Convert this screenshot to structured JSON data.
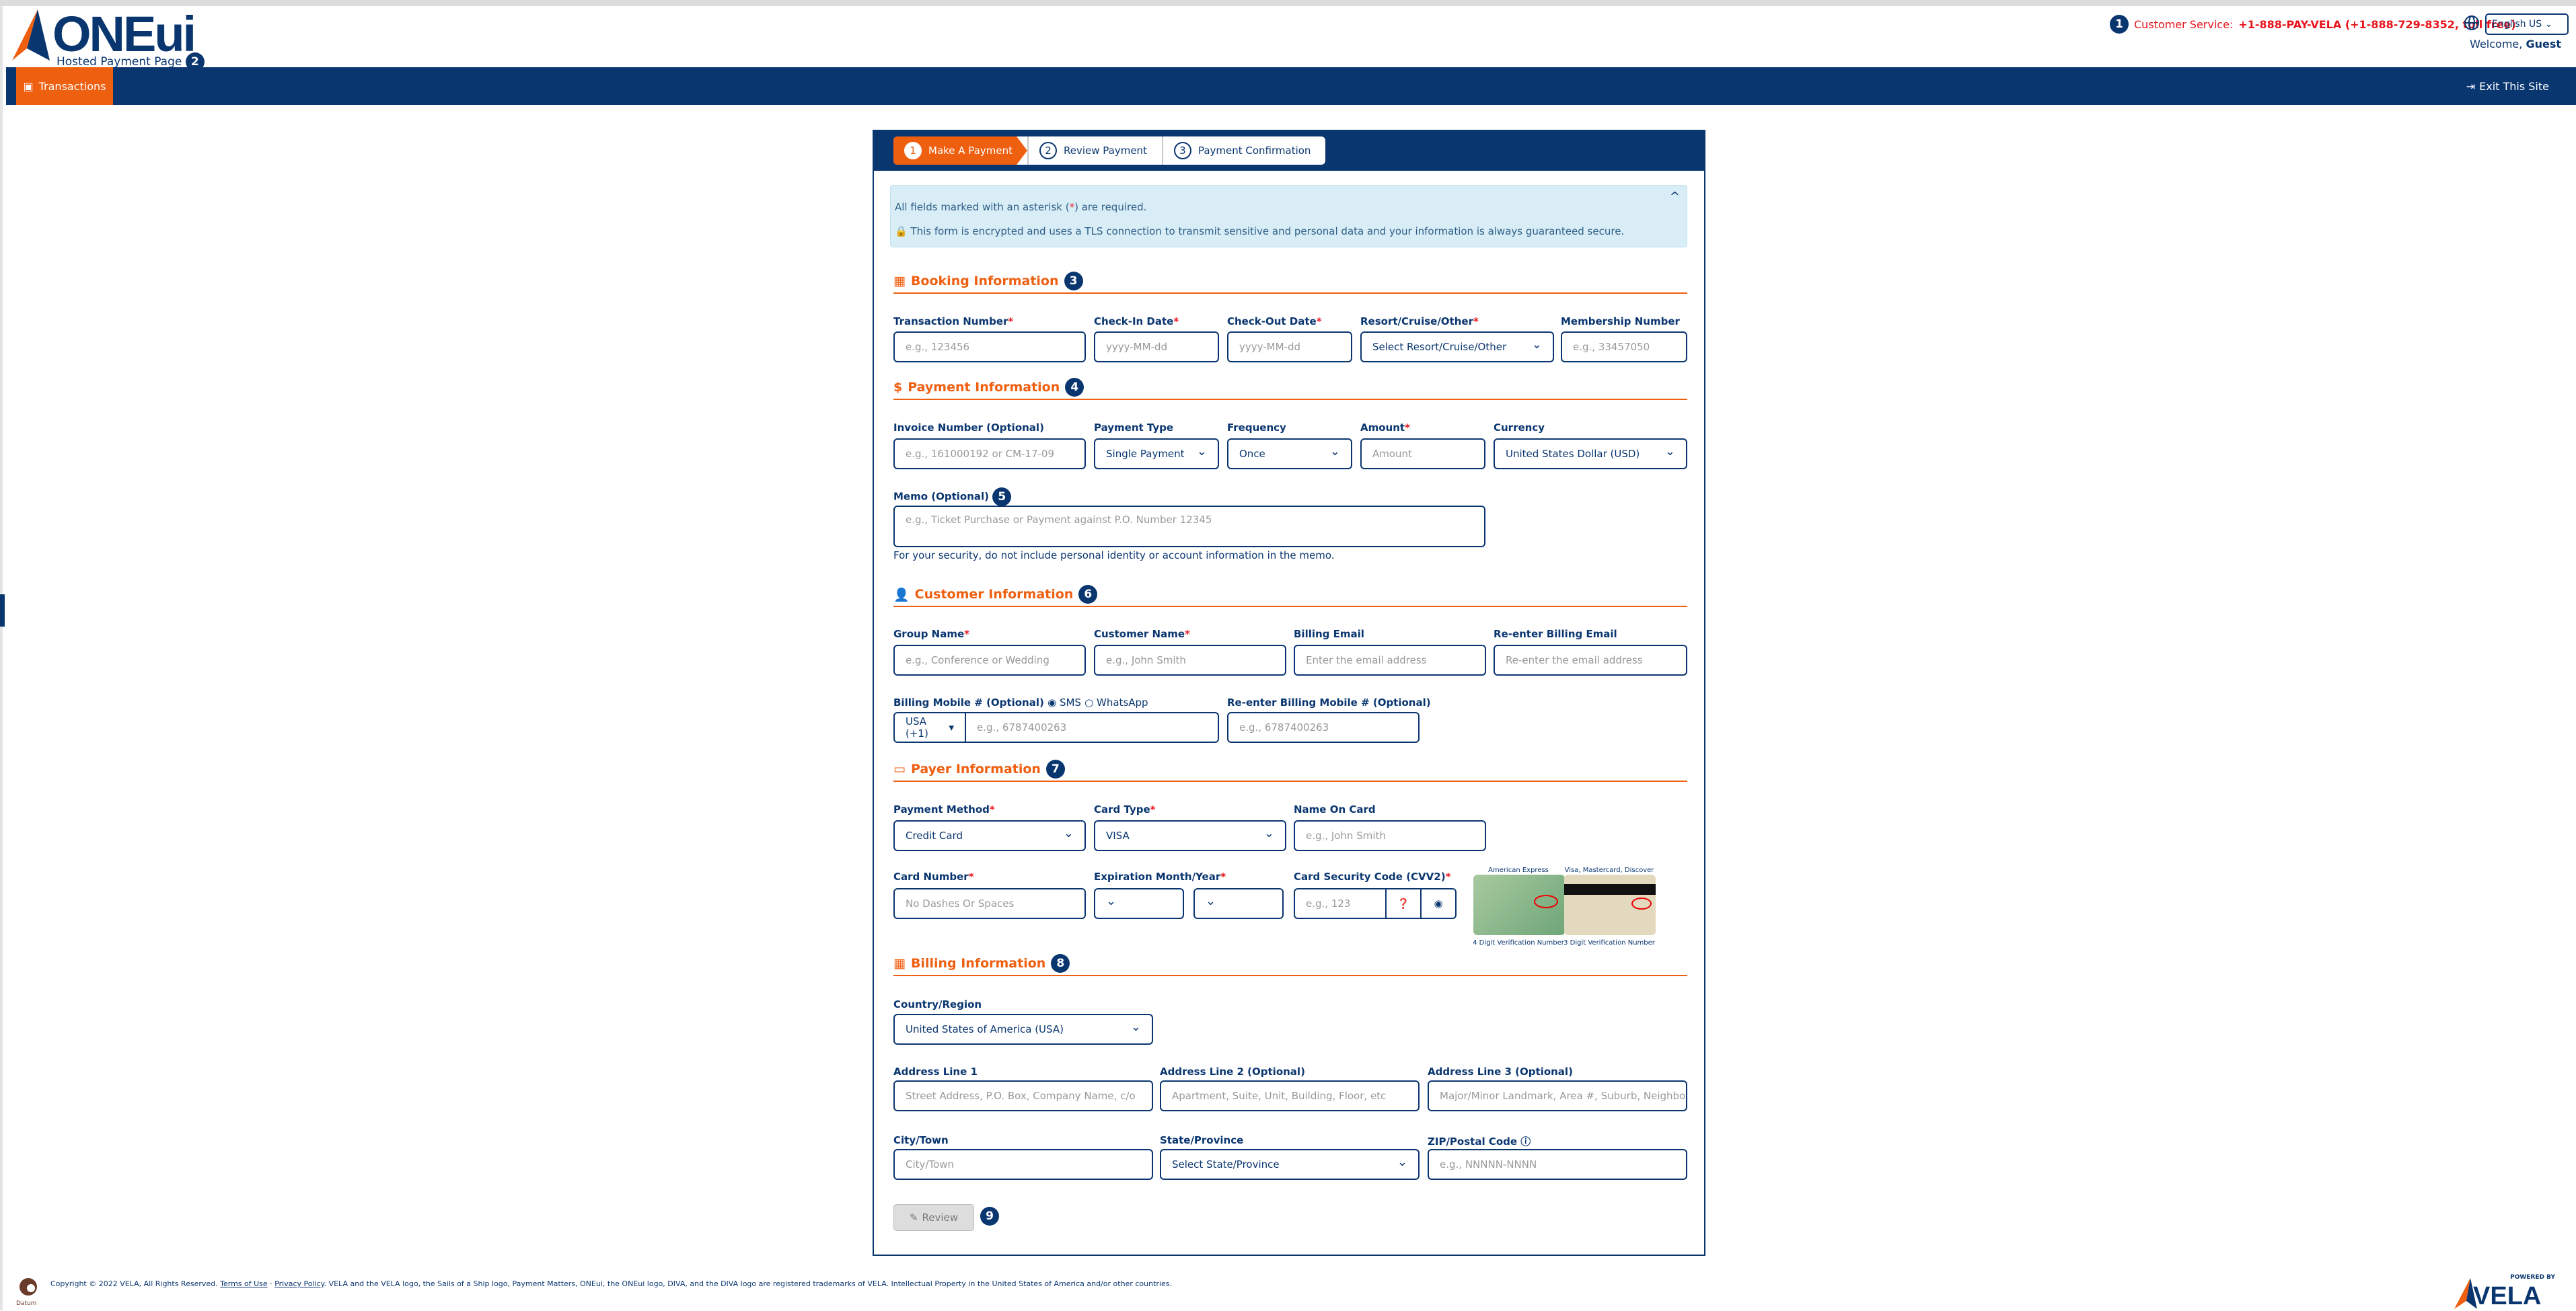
{
  "header": {
    "logo_text": "ONEui",
    "subtitle": "Hosted Payment Page",
    "badge_logo": "2",
    "badge_cs": "1",
    "customer_service_label": "Customer Service:",
    "customer_service_phone": "+1-888-PAY-VELA (+1-888-729-8352, toll free)",
    "language": "English US",
    "welcome": "Welcome,",
    "user": "Guest"
  },
  "nav": {
    "tab": "Transactions",
    "exit": "Exit This Site"
  },
  "steps": [
    {
      "num": "1",
      "label": "Make A Payment"
    },
    {
      "num": "2",
      "label": "Review Payment"
    },
    {
      "num": "3",
      "label": "Payment Confirmation"
    }
  ],
  "info": {
    "required_pre": "All fields marked with an asterisk (",
    "required_star": "*",
    "required_post": ") are required.",
    "secure": "This form is encrypted and uses a TLS connection to transmit sensitive and personal data and your information is always guaranteed secure."
  },
  "booking": {
    "title": "Booking Information",
    "badge": "3",
    "transaction_label": "Transaction Number",
    "transaction_ph": "e.g., 123456",
    "checkin_label": "Check-In Date",
    "checkin_ph": "yyyy-MM-dd",
    "checkout_label": "Check-Out Date",
    "checkout_ph": "yyyy-MM-dd",
    "resort_label": "Resort/Cruise/Other",
    "resort_value": "Select Resort/Cruise/Other",
    "membership_label": "Membership Number",
    "membership_ph": "e.g., 33457050"
  },
  "payment": {
    "title": "Payment Information",
    "badge": "4",
    "invoice_label": "Invoice Number (Optional)",
    "invoice_ph": "e.g., 161000192 or CM-17-09",
    "type_label": "Payment Type",
    "type_value": "Single Payment",
    "frequency_label": "Frequency",
    "frequency_value": "Once",
    "amount_label": "Amount",
    "amount_ph": "Amount",
    "currency_label": "Currency",
    "currency_value": "United States Dollar (USD)",
    "memo_label": "Memo (Optional)",
    "memo_badge": "5",
    "memo_ph": "e.g., Ticket Purchase or Payment against P.O. Number 12345",
    "memo_note": "For your security, do not include personal identity or account information in the memo."
  },
  "customer": {
    "title": "Customer Information",
    "badge": "6",
    "group_label": "Group Name",
    "group_ph": "e.g., Conference or Wedding",
    "name_label": "Customer Name",
    "name_ph": "e.g., John Smith",
    "email_label": "Billing Email",
    "email_ph": "Enter the email address",
    "reemail_label": "Re-enter Billing Email",
    "reemail_ph": "Re-enter the email address",
    "mobile_label": "Billing Mobile # (Optional)",
    "sms": "SMS",
    "whatsapp": "WhatsApp",
    "country_code": "USA (+1)",
    "mobile_ph": "e.g., 6787400263",
    "remobile_label": "Re-enter Billing Mobile # (Optional)",
    "remobile_ph": "e.g., 6787400263"
  },
  "payer": {
    "title": "Payer Information",
    "badge": "7",
    "method_label": "Payment Method",
    "method_value": "Credit Card",
    "cardtype_label": "Card Type",
    "cardtype_value": "VISA",
    "nameoncard_label": "Name On Card",
    "nameoncard_ph": "e.g., John Smith",
    "cardnum_label": "Card Number",
    "cardnum_ph": "No Dashes Or Spaces",
    "exp_label": "Expiration Month/Year",
    "cvv_label": "Card Security Code (CVV2)",
    "cvv_ph": "e.g., 123",
    "amex_title": "American Express",
    "amex_caption": "4 Digit Verification Number",
    "visa_title": "Visa, Mastercard, Discover",
    "visa_caption": "3 Digit Verification Number"
  },
  "billing": {
    "title": "Billing Information",
    "badge": "8",
    "country_label": "Country/Region",
    "country_value": "United States of America (USA)",
    "addr1_label": "Address Line 1",
    "addr1_ph": "Street Address, P.O. Box, Company Name, c/o",
    "addr2_label": "Address Line 2 (Optional)",
    "addr2_ph": "Apartment, Suite, Unit, Building, Floor, etc",
    "addr3_label": "Address Line 3 (Optional)",
    "addr3_ph": "Major/Minor Landmark, Area #, Suburb, Neighbor",
    "city_label": "City/Town",
    "city_ph": "City/Town",
    "state_label": "State/Province",
    "state_value": "Select State/Province",
    "zip_label": "ZIP/Postal Code",
    "zip_ph": "e.g., NNNNN-NNNN"
  },
  "review": {
    "label": "Review",
    "badge": "9"
  },
  "footer": {
    "copyright": "Copyright © 2022 VELA, All Rights Reserved.",
    "terms": "Terms of Use",
    "sep": " · ",
    "privacy": "Privacy Policy",
    "trademark": ". VELA and the VELA logo, the Sails of a Ship logo, Payment Matters, ONEui, the ONEui logo, DIVA, and the DIVA logo are registered trademarks of VELA. Intellectual Property in the United States of America and/or other countries.",
    "datum": "Datum",
    "powered": "POWERED BY",
    "vela": "VELA"
  },
  "colors": {
    "navy": "#0a3670",
    "orange": "#ef5f10",
    "required": "#e8141c",
    "info_bg": "#d9edf7"
  }
}
